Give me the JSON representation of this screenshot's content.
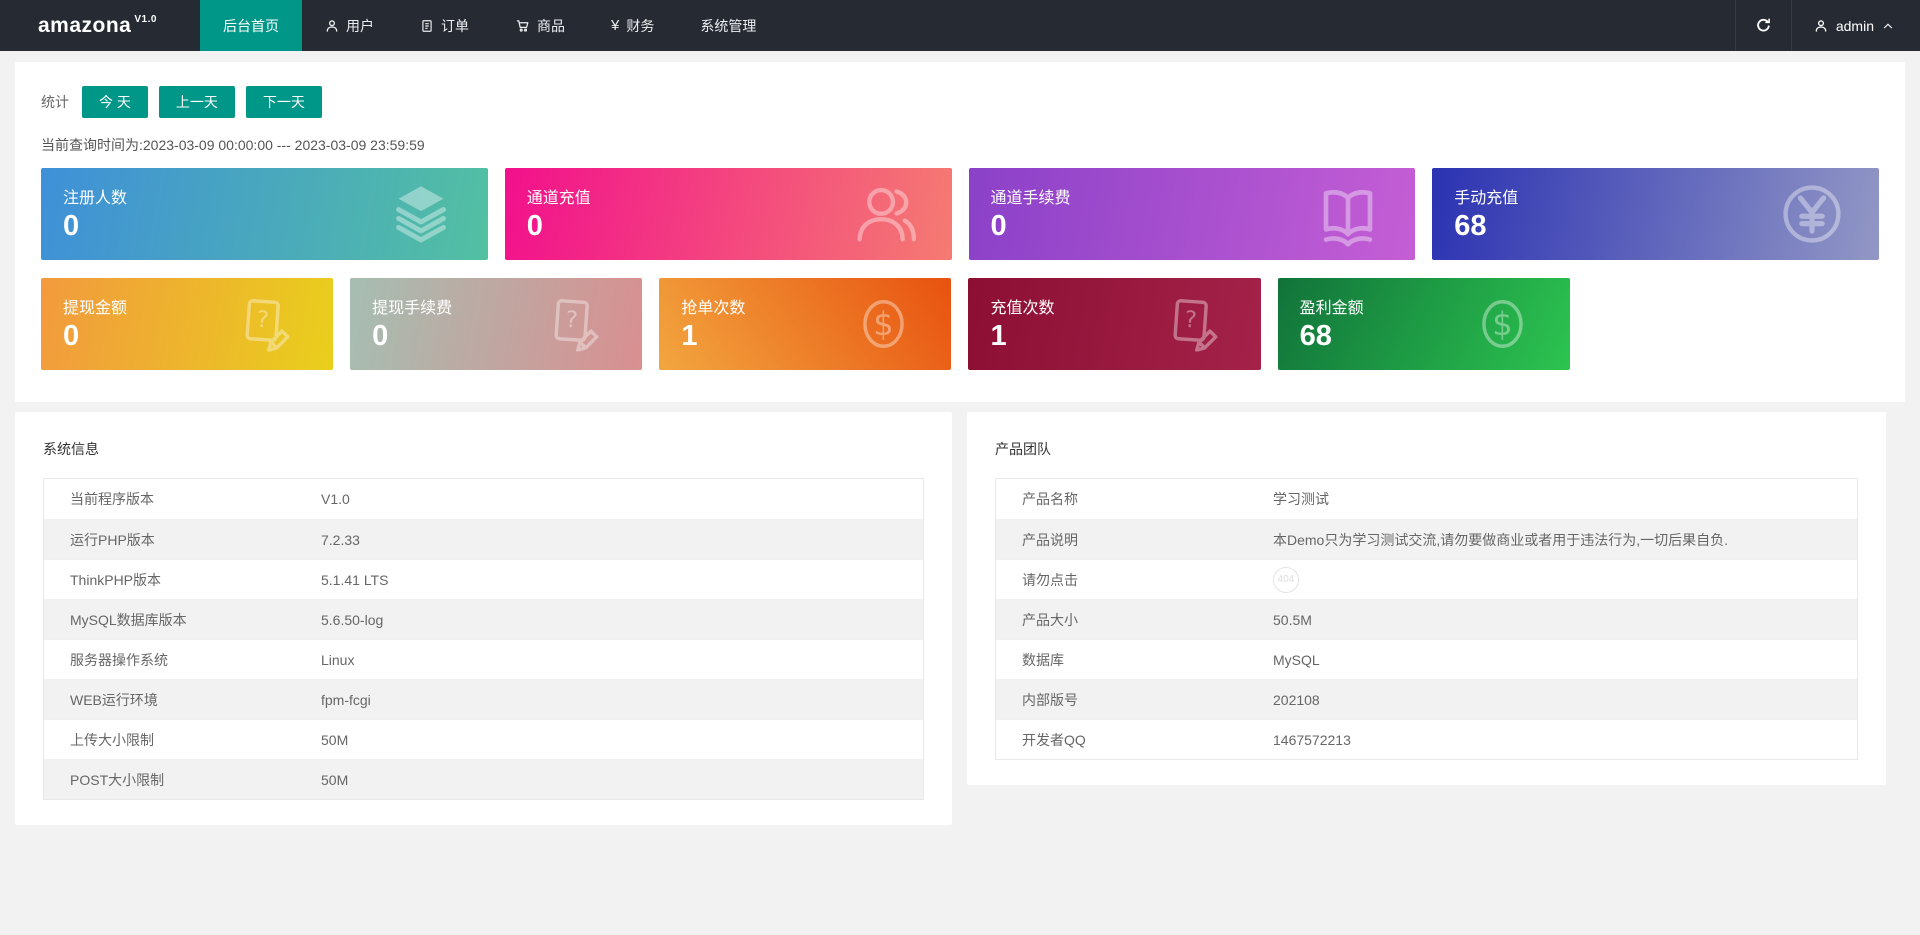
{
  "colors": {
    "navbar_bg": "#262b33",
    "accent_teal": "#009688",
    "page_bg": "#f2f2f2",
    "panel_bg": "#ffffff",
    "table_stripe": "#f2f2f2"
  },
  "navbar": {
    "logo": "amazona",
    "version": "V1.0",
    "items": [
      {
        "label": "后台首页",
        "icon": null,
        "active": true
      },
      {
        "label": "用户",
        "icon": "user-icon",
        "active": false
      },
      {
        "label": "订单",
        "icon": "order-doc-icon",
        "active": false
      },
      {
        "label": "商品",
        "icon": "cart-icon",
        "active": false
      },
      {
        "label": "财务",
        "icon": "yen-icon",
        "icon_text": "¥",
        "active": false
      },
      {
        "label": "系统管理",
        "icon": null,
        "active": false
      }
    ],
    "refresh_icon": "refresh-icon",
    "user": {
      "icon": "user-icon",
      "name": "admin",
      "caret_icon": "chevron-up-icon"
    }
  },
  "stats": {
    "label": "统计",
    "buttons": [
      {
        "label": "今 天"
      },
      {
        "label": "上一天"
      },
      {
        "label": "下一天"
      }
    ],
    "query_time": "当前查询时间为:2023-03-09 00:00:00 --- 2023-03-09 23:59:59",
    "cards_row1": [
      {
        "title": "注册人数",
        "value": "0",
        "icon": "layers-icon",
        "gradient": {
          "angle": "100deg",
          "from": "#3f90d8",
          "to": "#53c0a2"
        }
      },
      {
        "title": "通道充值",
        "value": "0",
        "icon": "users-icon",
        "gradient": {
          "angle": "100deg",
          "from": "#f2108c",
          "to": "#f57b72"
        }
      },
      {
        "title": "通道手续费",
        "value": "0",
        "icon": "open-book-icon",
        "gradient": {
          "angle": "100deg",
          "from": "#8a41c8",
          "to": "#c55ed5"
        }
      },
      {
        "title": "手动充值",
        "value": "68",
        "icon": "yen-circle-icon",
        "gradient": {
          "angle": "100deg",
          "from": "#2b32b2",
          "to": "#9297c5"
        }
      }
    ],
    "cards_row2": [
      {
        "title": "提现金额",
        "value": "0",
        "icon": "doc-question-pencil-icon",
        "gradient": {
          "angle": "100deg",
          "from": "#f29a3e",
          "to": "#e9cf1c"
        }
      },
      {
        "title": "提现手续费",
        "value": "0",
        "icon": "doc-question-pencil-icon",
        "gradient": {
          "angle": "100deg",
          "from": "#a6beb2",
          "to": "#d98f90"
        }
      },
      {
        "title": "抢单次数",
        "value": "1",
        "icon": "dollar-circle-icon",
        "gradient": {
          "angle": "55deg",
          "from": "#f2a63f",
          "to": "#e85210"
        }
      },
      {
        "title": "充值次数",
        "value": "1",
        "icon": "doc-question-pencil-icon",
        "gradient": {
          "angle": "100deg",
          "from": "#8c0f33",
          "to": "#a42249"
        }
      },
      {
        "title": "盈利金额",
        "value": "68",
        "icon": "dollar-circle-icon",
        "gradient": {
          "angle": "115deg",
          "from": "#11733a",
          "to": "#2cc450"
        }
      }
    ]
  },
  "system_info": {
    "title": "系统信息",
    "rows": [
      {
        "label": "当前程序版本",
        "value": "V1.0"
      },
      {
        "label": "运行PHP版本",
        "value": "7.2.33"
      },
      {
        "label": "ThinkPHP版本",
        "value": "5.1.41 LTS"
      },
      {
        "label": "MySQL数据库版本",
        "value": "5.6.50-log"
      },
      {
        "label": "服务器操作系统",
        "value": "Linux"
      },
      {
        "label": "WEB运行环境",
        "value": "fpm-fcgi"
      },
      {
        "label": "上传大小限制",
        "value": "50M"
      },
      {
        "label": "POST大小限制",
        "value": "50M"
      }
    ]
  },
  "product_team": {
    "title": "产品团队",
    "rows": [
      {
        "label": "产品名称",
        "value": "学习测试"
      },
      {
        "label": "产品说明",
        "value": "本Demo只为学习测试交流,请勿要做商业或者用于违法行为,一切后果自负."
      },
      {
        "label": "请勿点击",
        "badge": "404"
      },
      {
        "label": "产品大小",
        "value": "50.5M"
      },
      {
        "label": "数据库",
        "value": "MySQL"
      },
      {
        "label": "内部版号",
        "value": "202108"
      },
      {
        "label": "开发者QQ",
        "value": "1467572213"
      }
    ]
  }
}
